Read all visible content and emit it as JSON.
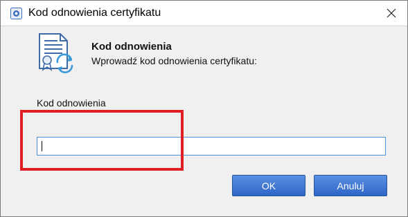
{
  "window": {
    "title": "Kod odnowienia certyfikatu",
    "close_glyph": "✕"
  },
  "dialog": {
    "heading": "Kod odnowienia",
    "subheading": "Wprowadź kod odnowienia certyfikatu:",
    "field_label": "Kod odnowienia",
    "field_value": "",
    "ok_label": "OK",
    "cancel_label": "Anuluj"
  },
  "colors": {
    "highlight": "#e01f25",
    "button": "#2f66c7",
    "input_border": "#4a90d9"
  },
  "icons": [
    "app-icon",
    "certificate-renew-icon",
    "close-icon"
  ]
}
